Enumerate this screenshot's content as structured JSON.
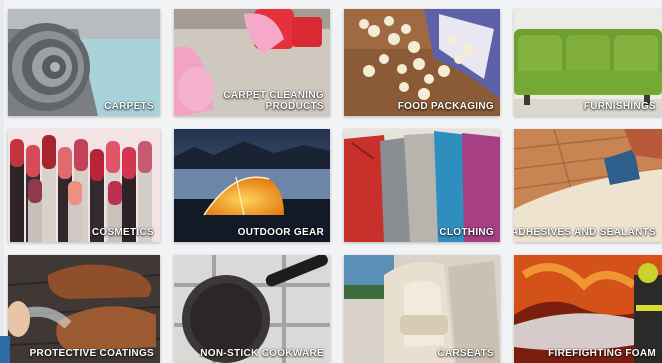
{
  "tiles": [
    {
      "id": "carpets",
      "label": "CARPETS"
    },
    {
      "id": "carpet-cleaning",
      "label_line1": "CARPET CLEANING",
      "label_line2": "PRODUCTS"
    },
    {
      "id": "food-packaging",
      "label": "FOOD PACKAGING"
    },
    {
      "id": "furnishings",
      "label": "FURNISHINGS"
    },
    {
      "id": "cosmetics",
      "label": "COSMETICS"
    },
    {
      "id": "outdoor-gear",
      "label": "OUTDOOR GEAR"
    },
    {
      "id": "clothing",
      "label": "CLOTHING"
    },
    {
      "id": "adhesives",
      "label": "ADHESIVES AND SEALANTS"
    },
    {
      "id": "protective-coatings",
      "label": "PROTECTIVE COATINGS"
    },
    {
      "id": "non-stick-cookware",
      "label": "NON-STICK COOKWARE"
    },
    {
      "id": "carseats",
      "label": "CARSEATS"
    },
    {
      "id": "firefighting-foam",
      "label": "FIREFIGHTING FOAM"
    }
  ]
}
